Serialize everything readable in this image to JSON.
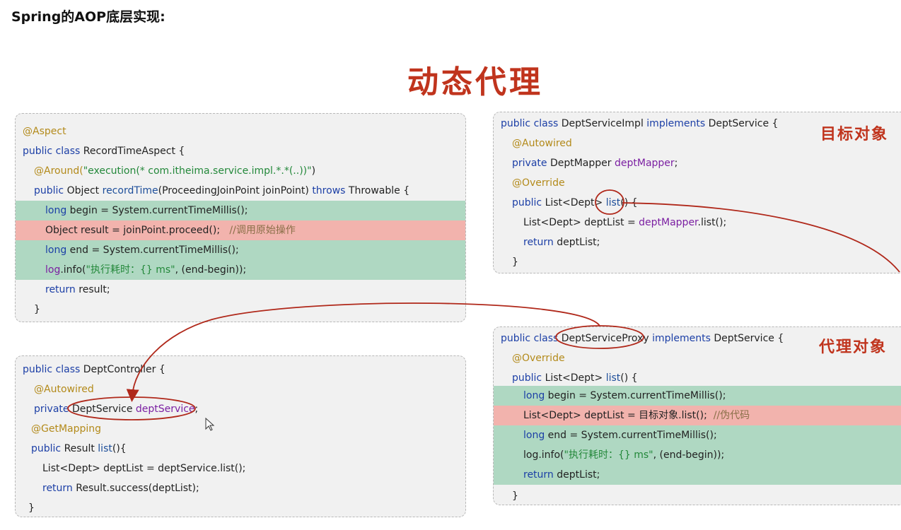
{
  "heading": "Spring的AOP底层实现:",
  "big_title": "动态代理",
  "labels": {
    "target": "目标对象",
    "proxy": "代理对象"
  },
  "aspect": {
    "l1": "@Aspect",
    "l2_kw": "public class ",
    "l2_rest": "RecordTimeAspect {",
    "l3_ann": "@Around(",
    "l3_str": "\"execution(* com.itheima.service.impl.*.*(..))\"",
    "l3_end": ")",
    "l4_kw": "public ",
    "l4_a": "Object ",
    "l4_fn": "recordTime",
    "l4_b": "(ProceedingJoinPoint joinPoint) ",
    "l4_kw2": "throws ",
    "l4_c": "Throwable {",
    "l5_kw": "long ",
    "l5_rest": "begin = System.currentTimeMillis();",
    "l6_code": "Object result = joinPoint.proceed();   ",
    "l6_cmt": "//调用原始操作",
    "l7_kw": "long ",
    "l7_rest": "end = System.currentTimeMillis();",
    "l8_var": "log",
    "l8_a": ".info(",
    "l8_str": "\"执行耗时：{} ms\"",
    "l8_b": ", (end-begin));",
    "l9_kw": "return ",
    "l9_rest": "result;",
    "l10": "}"
  },
  "controller": {
    "l1_kw": "public class ",
    "l1_rest": "DeptController {",
    "l2": "@Autowired",
    "l3_kw": "private ",
    "l3_a": "DeptService ",
    "l3_var": "deptService",
    "l3_b": ";",
    "l4": "@GetMapping",
    "l5_kw": "public ",
    "l5_a": "Result ",
    "l5_fn": "list",
    "l5_b": "(){",
    "l6": "List<Dept> deptList = deptService.list();",
    "l7_kw": "return ",
    "l7_rest": "Result.success(deptList);",
    "l8": "}"
  },
  "impl": {
    "l1_kw": "public class ",
    "l1_a": "DeptServiceImpl ",
    "l1_kw2": "implements ",
    "l1_b": "DeptService {",
    "l2": "@Autowired",
    "l3_kw": "private ",
    "l3_a": "DeptMapper ",
    "l3_var": "deptMapper",
    "l3_b": ";",
    "l4": "@Override",
    "l5_kw": "public ",
    "l5_a": "List<Dept> ",
    "l5_fn": "list",
    "l5_b": "() {",
    "l6_a": "List<Dept> deptList = ",
    "l6_var": "deptMapper",
    "l6_b": ".list();",
    "l7_kw": "return ",
    "l7_rest": "deptList;",
    "l8": "}"
  },
  "proxy": {
    "l1_kw": "public class ",
    "l1_a": "DeptServiceProxy ",
    "l1_kw2": "implements ",
    "l1_b": "DeptService {",
    "l2": "@Override",
    "l3_kw": "public ",
    "l3_a": "List<Dept> ",
    "l3_fn": "list",
    "l3_b": "() {",
    "l4_kw": "long ",
    "l4_rest": "begin = System.currentTimeMillis();",
    "l5_code": "List<Dept> deptList = 目标对象.list();  ",
    "l5_cmt": "//伪代码",
    "l6_kw": "long ",
    "l6_rest": "end = System.currentTimeMillis();",
    "l7_a": "log.info(",
    "l7_str": "\"执行耗时：{} ms\"",
    "l7_b": ", (end-begin));",
    "l8_kw": "return ",
    "l8_rest": "deptList;",
    "l9": "}"
  },
  "colors": {
    "accent_red": "#c0341d",
    "keyword": "#1c3fa6",
    "annotation": "#b38a1a",
    "string": "#23883a",
    "highlight_green": "#afd8c2",
    "highlight_red": "#f2b3ad"
  }
}
